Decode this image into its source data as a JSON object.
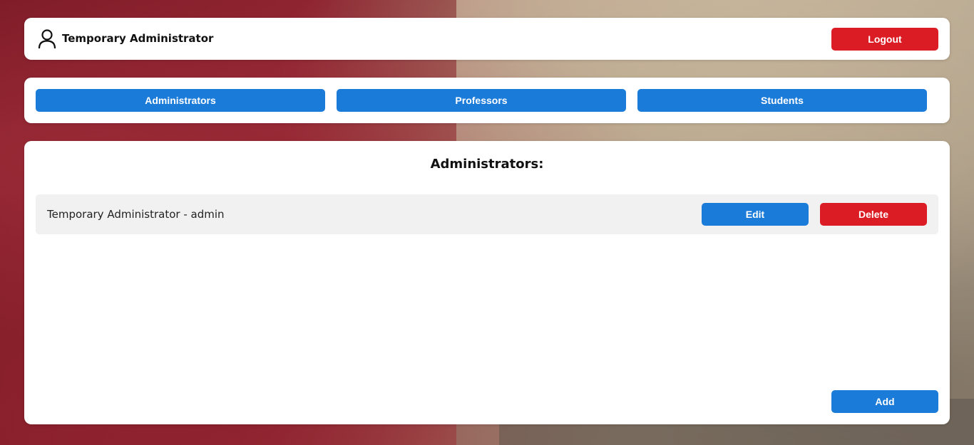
{
  "header": {
    "user_icon": "user-icon",
    "user_name": "Temporary Administrator",
    "logout_label": "Logout"
  },
  "nav": {
    "tabs": [
      {
        "label": "Administrators"
      },
      {
        "label": "Professors"
      },
      {
        "label": "Students"
      }
    ]
  },
  "main": {
    "title": "Administrators:",
    "items": [
      {
        "text": "Temporary Administrator - admin",
        "edit_label": "Edit",
        "delete_label": "Delete"
      }
    ],
    "add_label": "Add"
  },
  "colors": {
    "primary": "#1b7bd8",
    "danger": "#dc1c24",
    "row_background": "#f1f1f1"
  }
}
